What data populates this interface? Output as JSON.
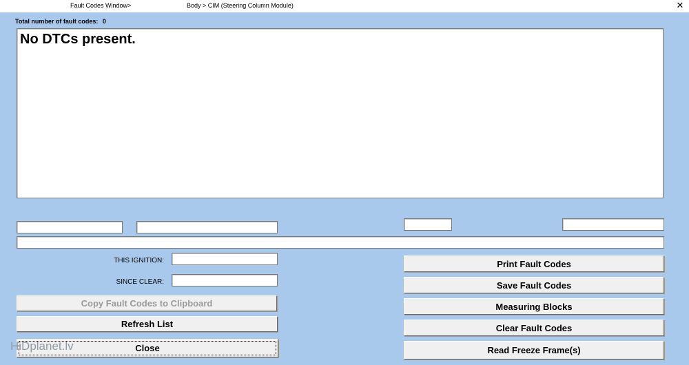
{
  "titlebar": {
    "window_label": "Fault Codes Window>",
    "module_path": "Body > CIM (Steering Column Module)",
    "close_glyph": "✕"
  },
  "fault_count": {
    "label": "Total number of fault codes:",
    "value": "0"
  },
  "dtc_list": {
    "message": "No DTCs present."
  },
  "info_fields": {
    "field_1": "",
    "field_2": "",
    "field_3": "",
    "field_4": "",
    "description": ""
  },
  "counters": {
    "this_ignition_label": "THIS IGNITION:",
    "this_ignition_value": "",
    "since_clear_label": "SINCE CLEAR:",
    "since_clear_value": ""
  },
  "buttons": {
    "copy_clipboard": "Copy Fault Codes to Clipboard",
    "refresh_list": "Refresh List",
    "close": "Close",
    "print_fault_codes": "Print Fault Codes",
    "save_fault_codes": "Save Fault Codes",
    "measuring_blocks": "Measuring Blocks",
    "clear_fault_codes": "Clear Fault Codes",
    "read_freeze_frames": "Read Freeze Frame(s)"
  },
  "watermark": "HiDplanet.lv",
  "colors": {
    "background": "#a8c8ec",
    "button_face": "#f0f0f0",
    "disabled_text": "#9a9a9a"
  }
}
